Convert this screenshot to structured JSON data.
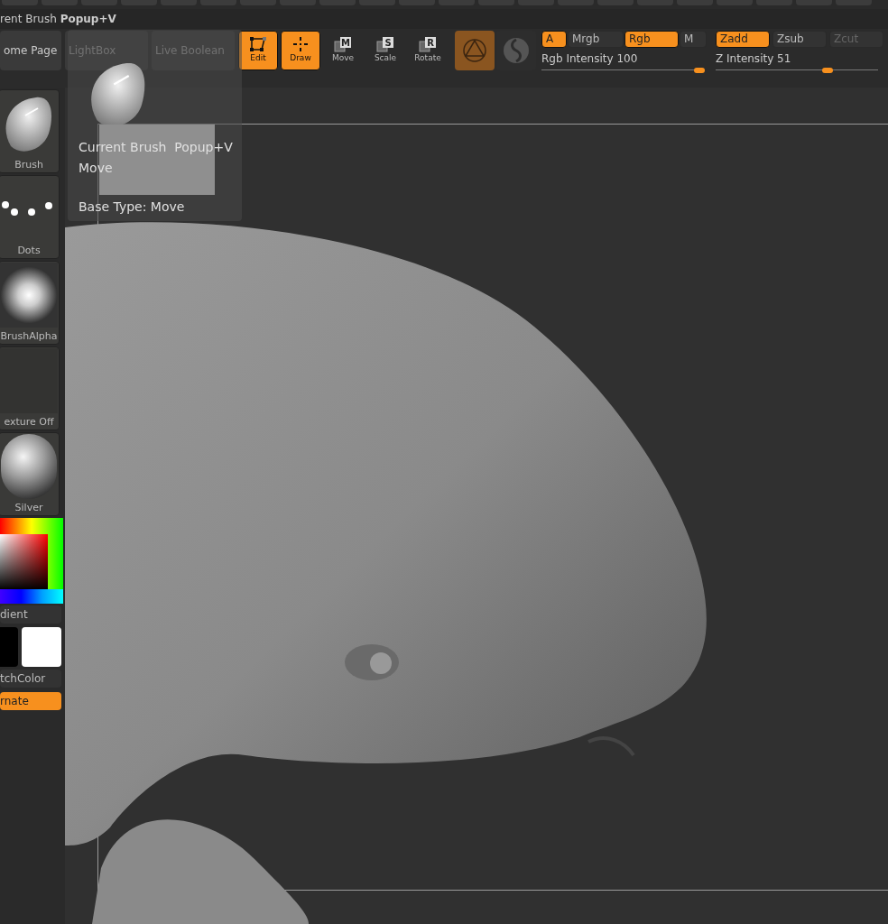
{
  "title_bar": {
    "text": "rent Brush **Popup+V**"
  },
  "toolbar": {
    "tabs": [
      {
        "label": "ome Page",
        "dimmed": false
      },
      {
        "label": "LightBox",
        "dimmed": true
      },
      {
        "label": "Live Boolean",
        "dimmed": true
      }
    ],
    "modes": [
      {
        "label": "Edit",
        "kind": "edit",
        "selected": true
      },
      {
        "label": "Draw",
        "kind": "draw",
        "selected": true
      },
      {
        "label": "Move",
        "kind": "move",
        "key": "M",
        "selected": false
      },
      {
        "label": "Scale",
        "kind": "scale",
        "key": "S",
        "selected": false
      },
      {
        "label": "Rotate",
        "kind": "rotate",
        "key": "R",
        "selected": false
      }
    ],
    "color_toggles": [
      {
        "label": "A",
        "selected": true,
        "disabled": false
      },
      {
        "label": "Mrgb",
        "selected": false,
        "disabled": false
      },
      {
        "label": "Rgb",
        "selected": true,
        "disabled": false
      },
      {
        "label": "M",
        "selected": false,
        "disabled": false
      }
    ],
    "z_toggles": [
      {
        "label": "Zadd",
        "selected": true,
        "disabled": false
      },
      {
        "label": "Zsub",
        "selected": false,
        "disabled": false
      },
      {
        "label": "Zcut",
        "selected": false,
        "disabled": true
      }
    ],
    "sliders": [
      {
        "label": "Rgb Intensity",
        "reading": "100",
        "level": 0.97
      },
      {
        "label": "Z Intensity",
        "reading": "51",
        "level": 0.69
      }
    ]
  },
  "sidebar": {
    "items": [
      {
        "label": "Brush",
        "kind": "brush"
      },
      {
        "label": "Dots",
        "kind": "dots"
      },
      {
        "label": "BrushAlpha",
        "kind": "alpha"
      },
      {
        "label": "exture Off",
        "kind": "texture"
      },
      {
        "label": "Silver",
        "kind": "material"
      },
      {
        "label": "dient",
        "kind": "picker"
      },
      {
        "label": "tchColor",
        "kind": "swatches"
      },
      {
        "label": "rnate",
        "kind": "alternate",
        "selected": true
      }
    ]
  },
  "popup": {
    "title": "Current Brush  Popup+V",
    "name": "Move",
    "base_type": "Base Type: Move"
  }
}
